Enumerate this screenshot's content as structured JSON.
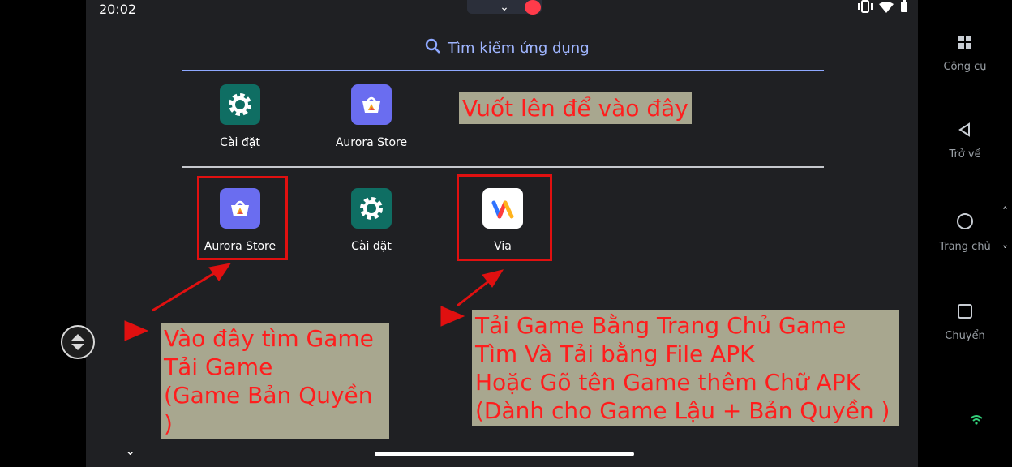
{
  "status_bar": {
    "time": "20:02"
  },
  "search": {
    "placeholder": "Tìm kiếm ứng dụng"
  },
  "top_apps": [
    {
      "label": "Cài đặt",
      "icon": "settings-gear-icon"
    },
    {
      "label": "Aurora Store",
      "icon": "aurora-store-icon"
    }
  ],
  "apps": [
    {
      "label": "Aurora Store",
      "icon": "aurora-store-icon"
    },
    {
      "label": "Cài đặt",
      "icon": "settings-gear-icon"
    },
    {
      "label": "Via",
      "icon": "via-browser-icon"
    }
  ],
  "annotations": {
    "top": "Vuốt lên để vào đây",
    "left": [
      "Vào đây tìm Game",
      "Tải Game",
      "(Game Bản Quyền )"
    ],
    "right": [
      "Tải Game Bằng Trang Chủ Game",
      "Tìm Và  Tải bằng File APK",
      "Hoặc Gõ tên Game thêm Chữ APK",
      "(Dành cho Game Lậu + Bản Quyền )"
    ]
  },
  "right_rail": {
    "tools": "Công cụ",
    "back": "Trở về",
    "home": "Trang chủ",
    "switch": "Chuyển"
  },
  "colors": {
    "annotation_text": "#ff1d1d",
    "annotation_bg": "#a8a78f",
    "highlight_box": "#e01010",
    "search_accent": "#8ea8ff"
  }
}
